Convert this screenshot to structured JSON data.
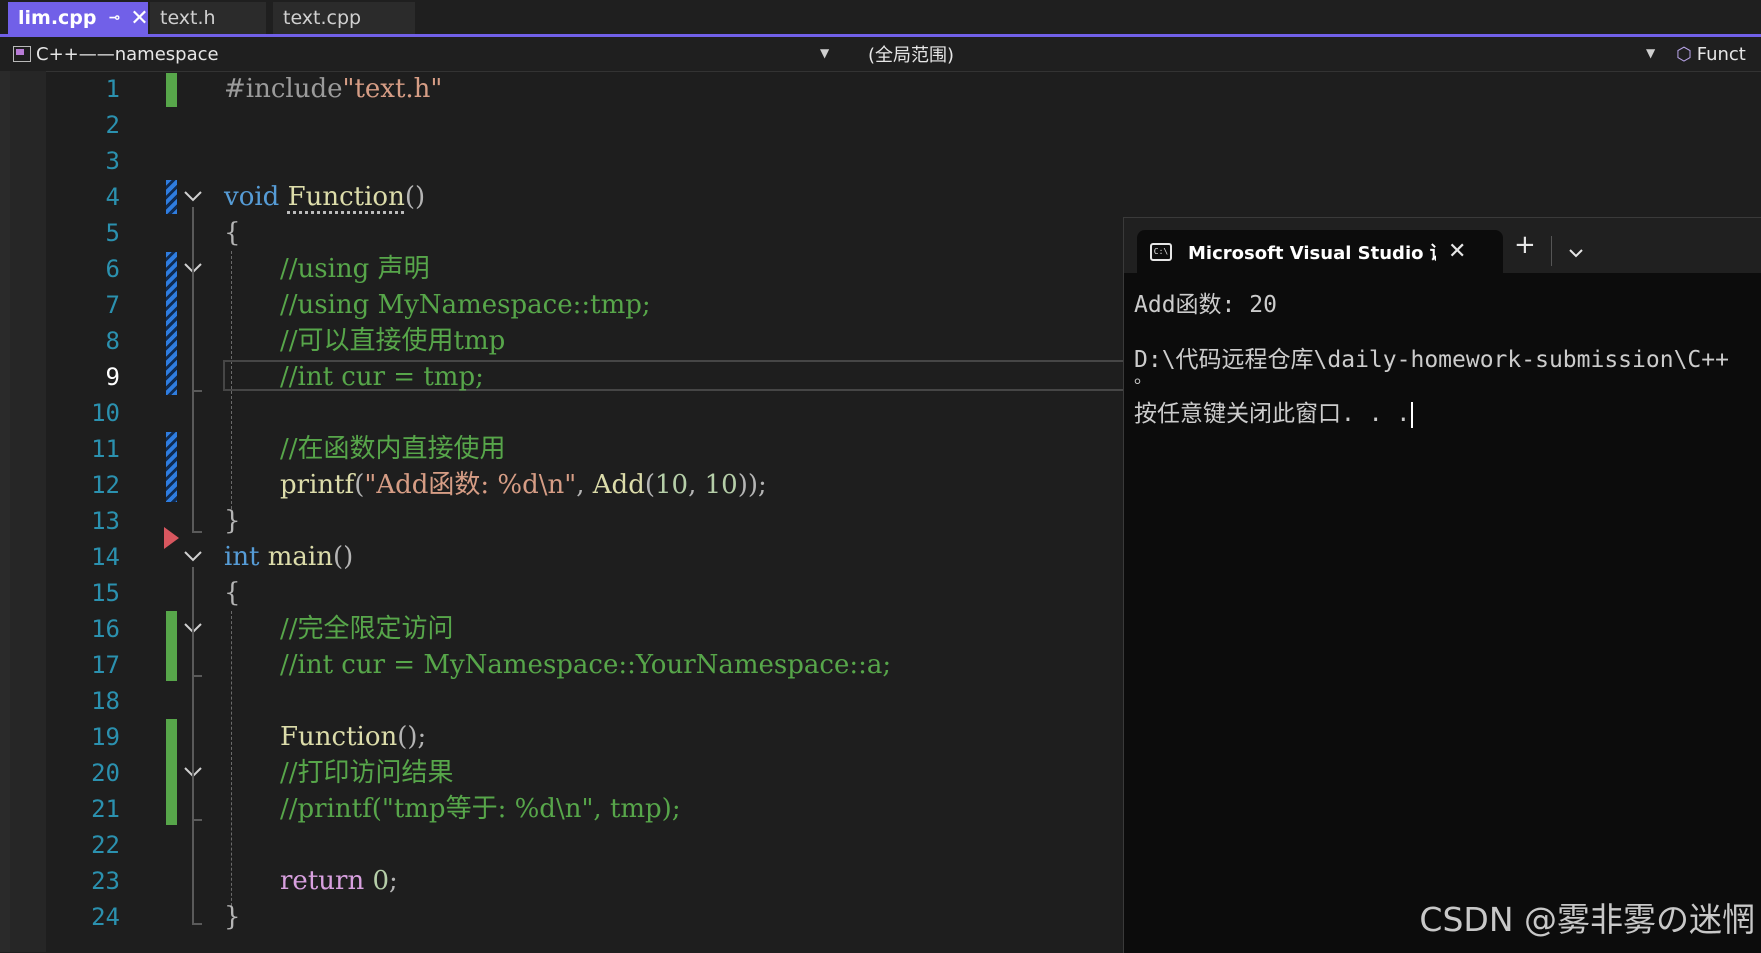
{
  "tabs": [
    {
      "label": "lim.cpp",
      "pin": "⊸",
      "close": "✕"
    },
    {
      "label": "text.h"
    },
    {
      "label": "text.cpp"
    }
  ],
  "navbar": {
    "project": "C++——namespace",
    "scope": "(全局范围)",
    "member": "Funct"
  },
  "editor": {
    "current_line": 9,
    "line_numbers": [
      "1",
      "2",
      "3",
      "4",
      "5",
      "6",
      "7",
      "8",
      "9",
      "10",
      "11",
      "12",
      "13",
      "14",
      "15",
      "16",
      "17",
      "18",
      "19",
      "20",
      "21",
      "22",
      "23",
      "24"
    ],
    "lines": {
      "l1": {
        "a": "#include",
        "b": "\"text.h\""
      },
      "l4": {
        "a": "void",
        "b": " ",
        "c": "Function",
        "d": "()"
      },
      "l5": "{",
      "l6": "//using 声明",
      "l7": "//using MyNamespace::tmp;",
      "l8": "//可以直接使用tmp",
      "l9": "//int cur = tmp;",
      "l11": "//在函数内直接使用",
      "l12": {
        "a": "printf",
        "b": "(",
        "c": "\"Add函数: %d\\n\"",
        "d": ", ",
        "e": "Add",
        "f": "(",
        "g": "10",
        "h": ", ",
        "i": "10",
        "j": "));"
      },
      "l13": "}",
      "l14": {
        "a": "int",
        "b": " ",
        "c": "main",
        "d": "()"
      },
      "l15": "{",
      "l16": "//完全限定访问",
      "l17": "//int cur = MyNamespace::YourNamespace::a;",
      "l19": {
        "a": "Function",
        "b": "();"
      },
      "l20": "//打印访问结果",
      "l21": "//printf(\"tmp等于: %d\\n\", tmp);",
      "l23": {
        "a": "return",
        "b": " ",
        "c": "0",
        "d": ";"
      },
      "l24": "}"
    }
  },
  "terminal": {
    "icon_text": "C:\\",
    "title": "Microsoft Visual Studio 调试控制台",
    "close": "✕",
    "new_tab": "+",
    "output": [
      "Add函数: 20",
      "D:\\代码远程仓库\\daily-homework-submission\\C++",
      "。",
      "按任意键关闭此窗口. . ."
    ]
  },
  "watermark": "CSDN @雾非雾の迷惘",
  "colors": {
    "accent": "#7160e8",
    "keyword": "#569cd6",
    "comment": "#57a64a",
    "string": "#d69d85",
    "line_number": "#2b91af"
  }
}
